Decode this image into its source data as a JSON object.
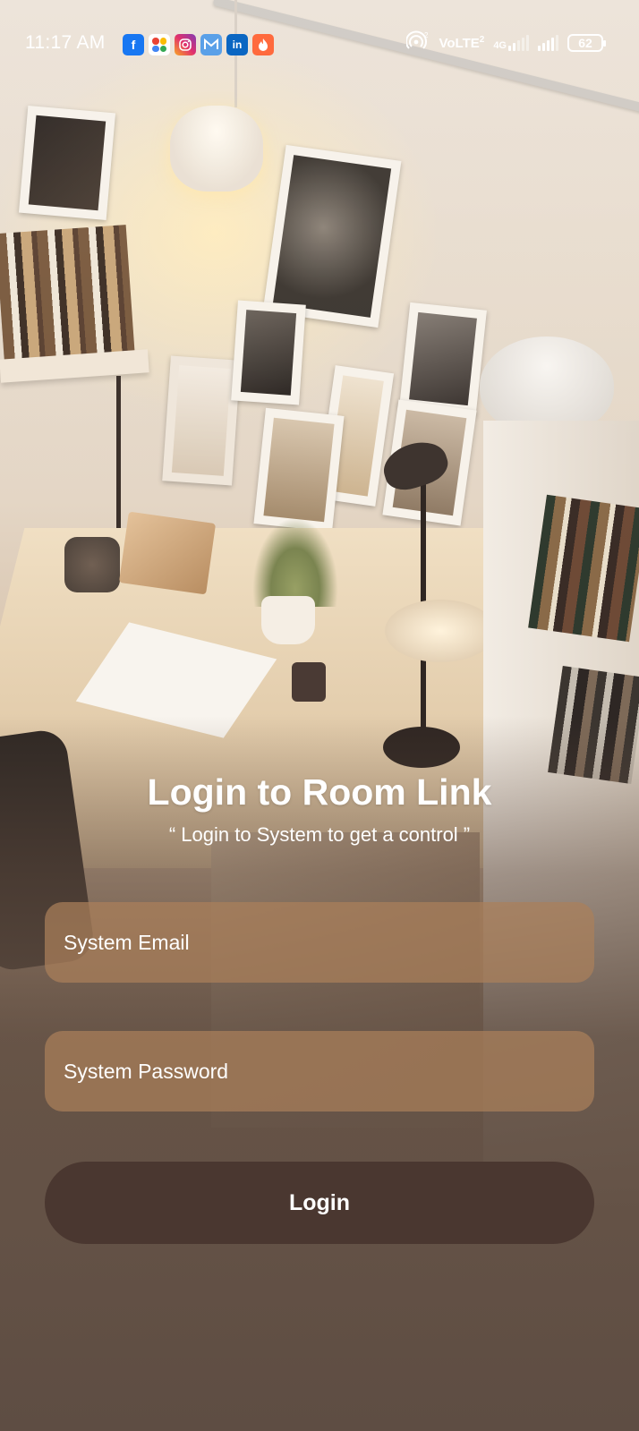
{
  "status_bar": {
    "time": "11:17 AM",
    "app_icons": [
      "facebook-icon",
      "google-photos-icon",
      "instagram-icon",
      "mail-icon",
      "linkedin-icon",
      "tinder-icon"
    ],
    "volte_label": "VoLTE",
    "volte_sim": "2",
    "network_type": "4G",
    "battery_level": "62"
  },
  "login": {
    "title": "Login to Room Link",
    "subtitle": "“ Login to System to get a control ”",
    "email_placeholder": "System Email",
    "password_placeholder": "System Password",
    "button_label": "Login"
  },
  "colors": {
    "field_bg": "#aa805a",
    "button_bg": "#4a3730",
    "text": "#ffffff"
  }
}
